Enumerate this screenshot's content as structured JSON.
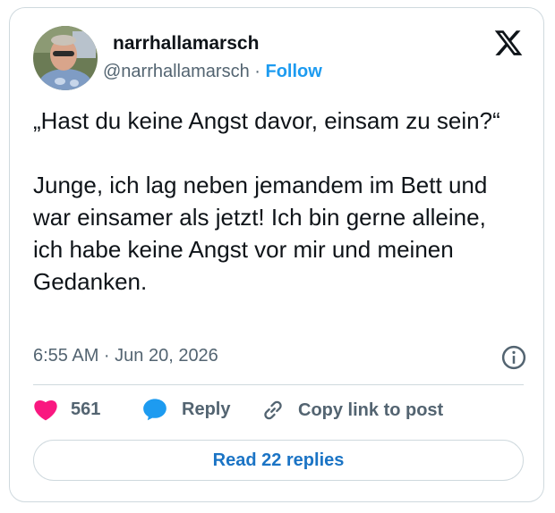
{
  "author": {
    "display_name": "narrhallamarsch",
    "handle": "@narrhallamarsch",
    "separator": "·",
    "follow_label": "Follow"
  },
  "tweet": {
    "text": "„Hast du keine Angst davor, einsam zu sein?“\n\nJunge, ich lag neben jemandem im Bett und war einsamer als jetzt! Ich bin gerne alleine, ich habe keine Angst vor mir und meinen Gedanken.",
    "timestamp": "6:55 AM · Jun 20, 2026"
  },
  "actions": {
    "like_count": "561",
    "reply_label": "Reply",
    "copy_label": "Copy link to post"
  },
  "read_replies_label": "Read 22 replies",
  "icons": {
    "logo": "x-logo-icon",
    "info": "info-icon",
    "like": "heart-icon",
    "reply": "speech-bubble-icon",
    "copy": "link-icon"
  },
  "colors": {
    "accent": "#1d9bf0",
    "like": "#f91880",
    "text": "#0f1419",
    "muted": "#536471",
    "border": "#cfd9de"
  }
}
